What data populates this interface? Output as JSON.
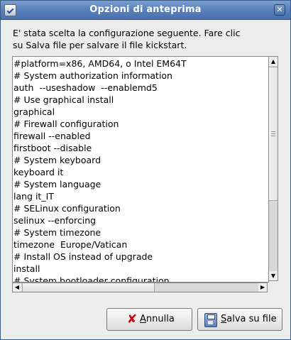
{
  "window": {
    "title": "Opzioni di anteprima",
    "close_glyph": "✕",
    "icon": "dialog-icon"
  },
  "message": {
    "line1": "E' stata scelta la configurazione seguente. Fare clic",
    "line2": "su Salva file per salvare il file kickstart."
  },
  "preview": {
    "lines": [
      "#platform=x86, AMD64, o Intel EM64T",
      "# System authorization information",
      "auth  --useshadow  --enablemd5",
      "# Use graphical install",
      "graphical",
      "# Firewall configuration",
      "firewall --enabled",
      "firstboot --disable",
      "# System keyboard",
      "keyboard it",
      "# System language",
      "lang it_IT",
      "# SELinux configuration",
      "selinux --enforcing",
      "# System timezone",
      "timezone  Europe/Vatican",
      "# Install OS instead of upgrade",
      "install",
      "# System bootloader configuration"
    ]
  },
  "scrollbars": {
    "up_glyph": "▲",
    "down_glyph": "▼",
    "left_glyph": "◀",
    "right_glyph": "▶"
  },
  "buttons": {
    "cancel": {
      "mnemonic": "A",
      "rest": "nnulla",
      "icon": "cancel-x-icon",
      "glyph": "✘"
    },
    "save": {
      "mnemonic": "S",
      "rest": "alva su file",
      "icon": "floppy-disk-icon"
    }
  }
}
